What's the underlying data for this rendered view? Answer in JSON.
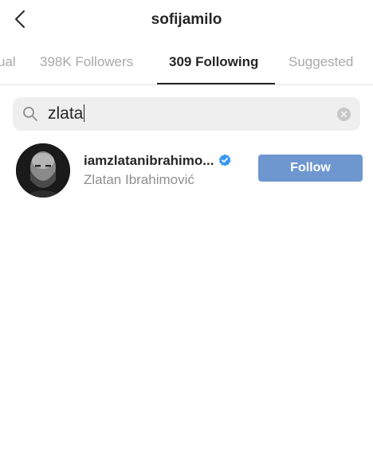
{
  "header": {
    "title": "sofijamilo",
    "back_icon": "chevron-left-icon"
  },
  "tabs": [
    {
      "label": "ual",
      "active": false
    },
    {
      "label": "398K Followers",
      "active": false
    },
    {
      "label": "309 Following",
      "active": true
    },
    {
      "label": "Suggested",
      "active": false
    }
  ],
  "search": {
    "value": "zlata",
    "icon": "search-icon",
    "clear_icon": "clear-icon"
  },
  "results": [
    {
      "username": "iamzlatanibrahimo...",
      "verified": true,
      "full_name": "Zlatan Ibrahimović",
      "button_label": "Follow"
    }
  ],
  "colors": {
    "follow_button": "#6e97cf",
    "verified_badge": "#3897f0",
    "secondary_text": "#8e8e8e",
    "inactive_tab": "#a8a8a8"
  }
}
